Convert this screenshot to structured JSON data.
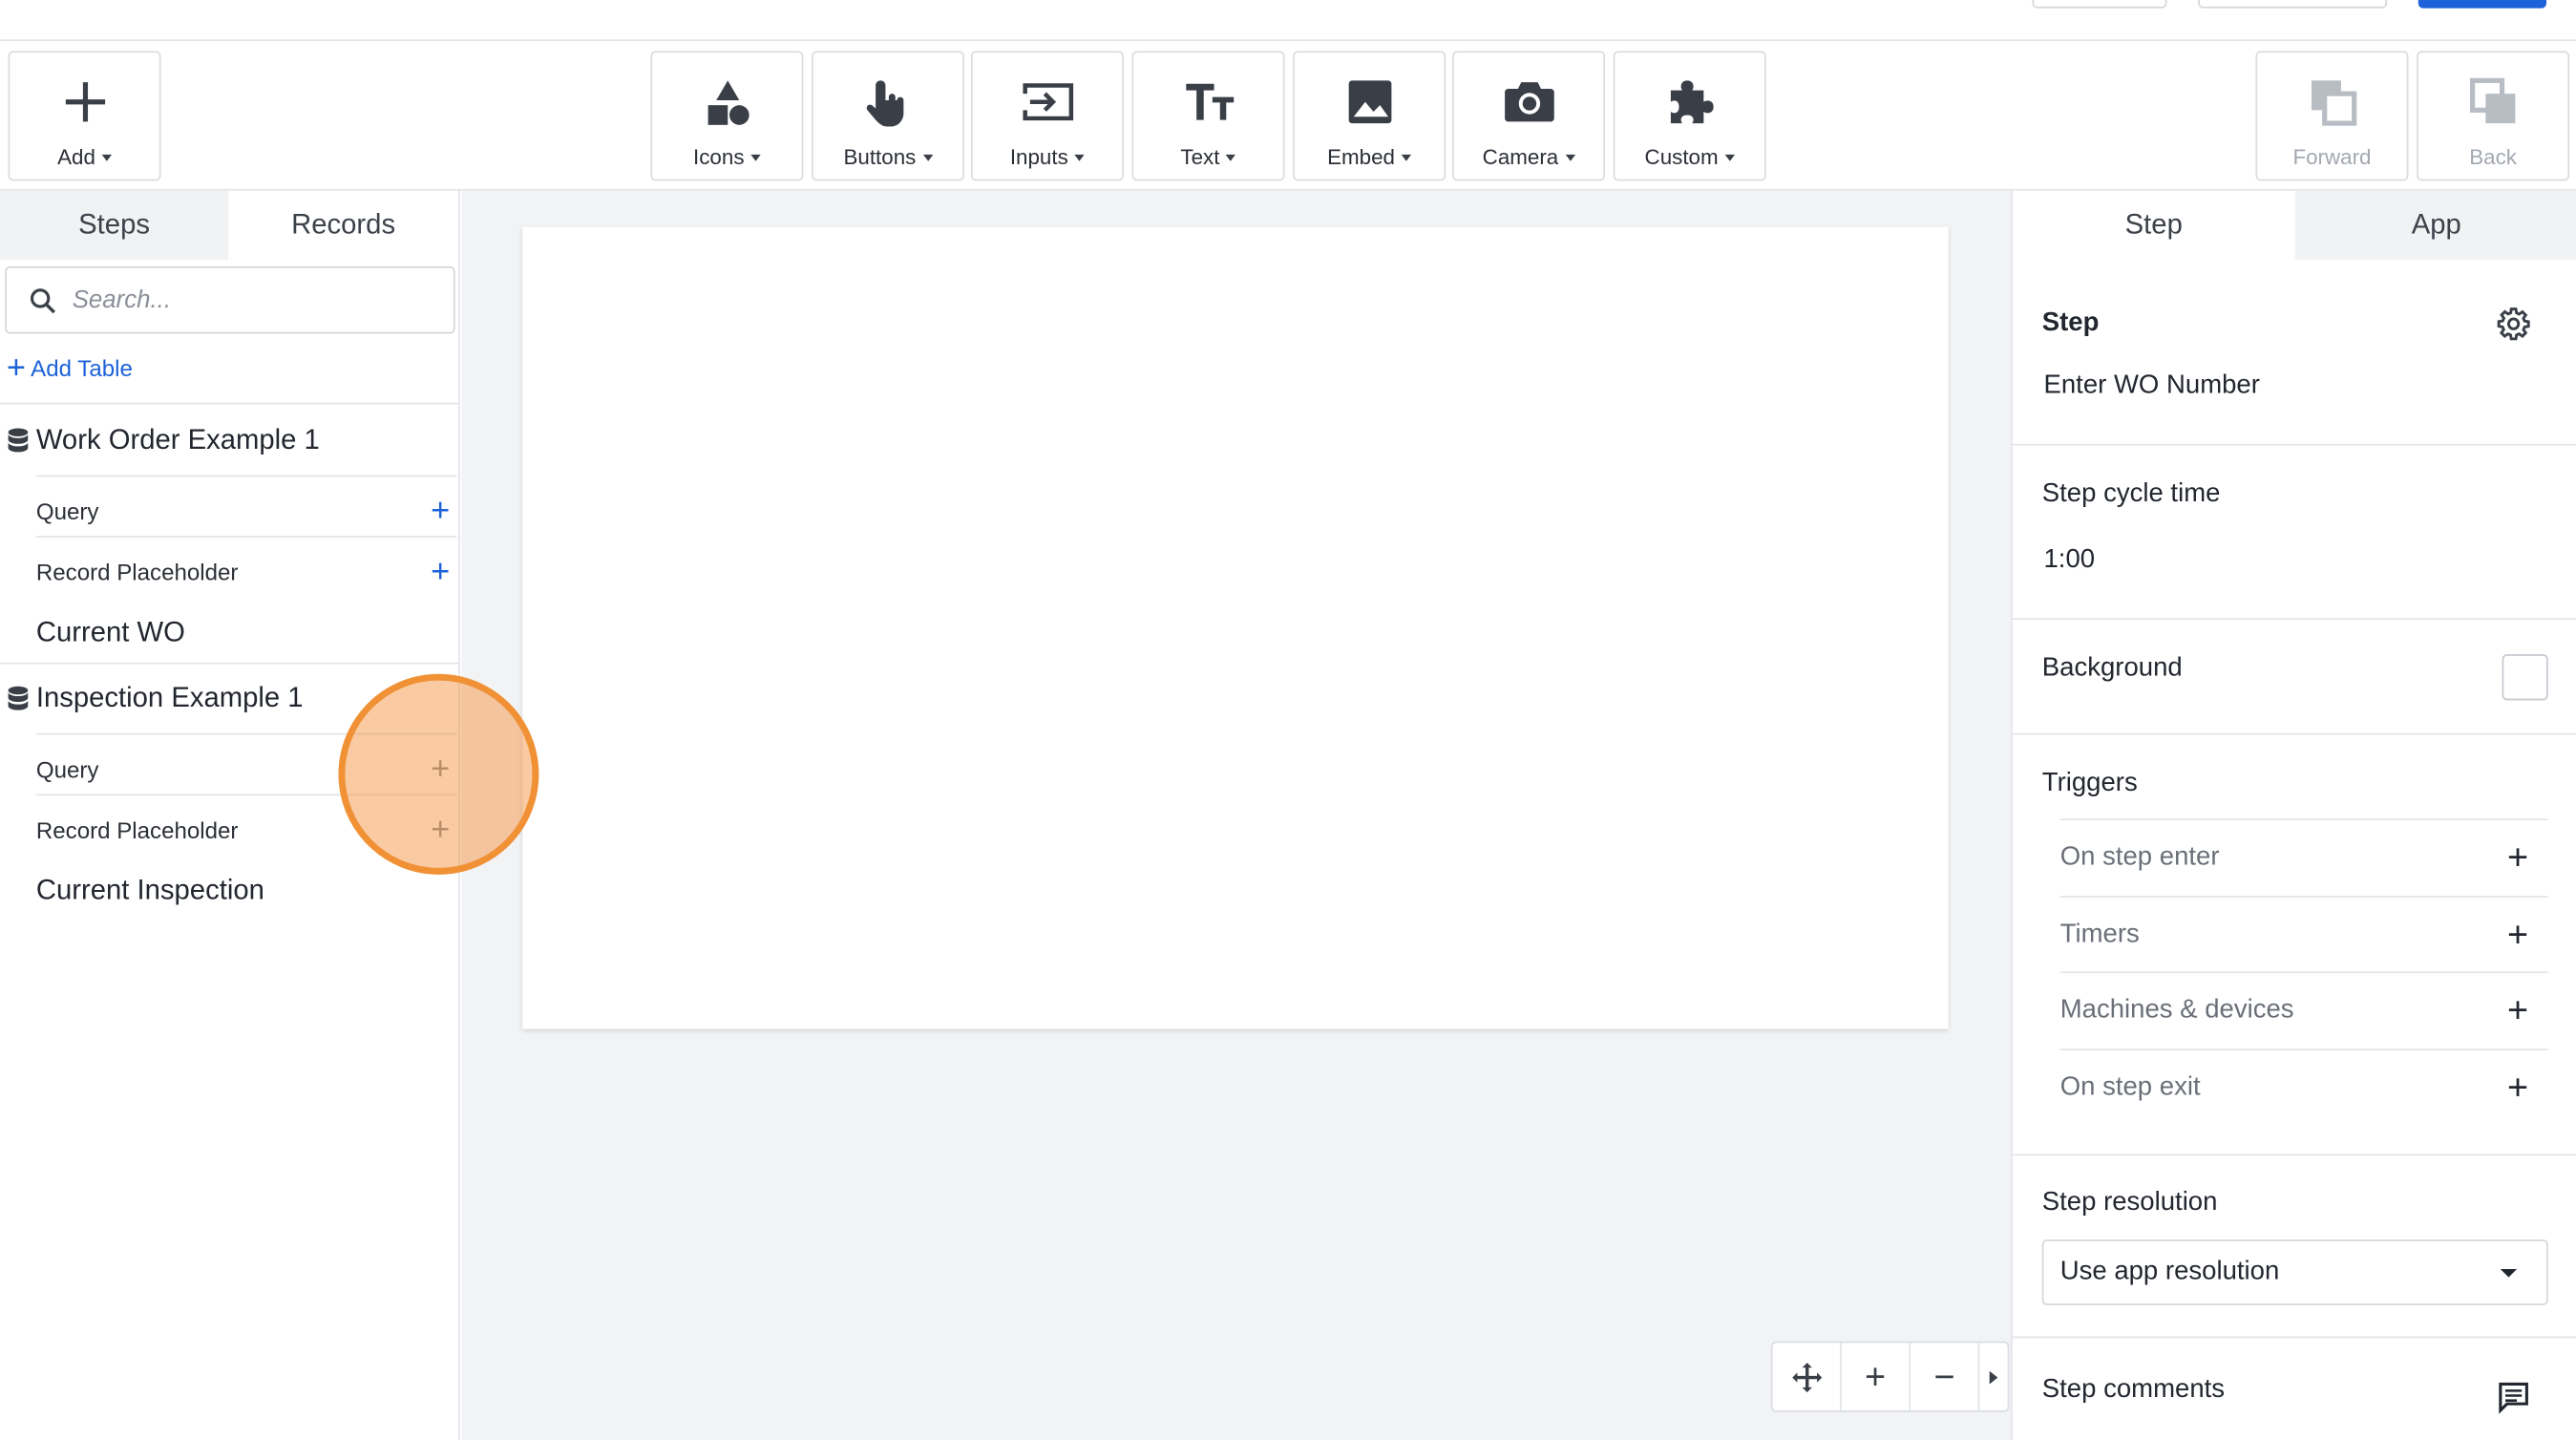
{
  "toolbar": {
    "add": "Add",
    "icons": "Icons",
    "buttons": "Buttons",
    "inputs": "Inputs",
    "text": "Text",
    "embed": "Embed",
    "camera": "Camera",
    "custom": "Custom",
    "forward": "Forward",
    "back": "Back"
  },
  "left": {
    "tabs": [
      "Steps",
      "Records"
    ],
    "active_tab": "Records",
    "search_placeholder": "Search...",
    "add_table": "Add Table",
    "tables": [
      {
        "name": "Work Order Example 1",
        "rows": [
          "Query",
          "Record Placeholder"
        ],
        "record": "Current WO"
      },
      {
        "name": "Inspection Example 1",
        "rows": [
          "Query",
          "Record Placeholder"
        ],
        "record": "Current Inspection"
      }
    ]
  },
  "right": {
    "tabs": [
      "Step",
      "App"
    ],
    "active_tab": "Step",
    "step_label": "Step",
    "step_name": "Enter WO Number",
    "cycle_label": "Step cycle time",
    "cycle_value": "1:00",
    "background_label": "Background",
    "triggers_label": "Triggers",
    "triggers": [
      "On step enter",
      "Timers",
      "Machines & devices",
      "On step exit"
    ],
    "resolution_label": "Step resolution",
    "resolution_value": "Use app resolution",
    "comments_label": "Step comments"
  },
  "colors": {
    "accent": "#1d62d9",
    "highlight": "#f19136"
  }
}
